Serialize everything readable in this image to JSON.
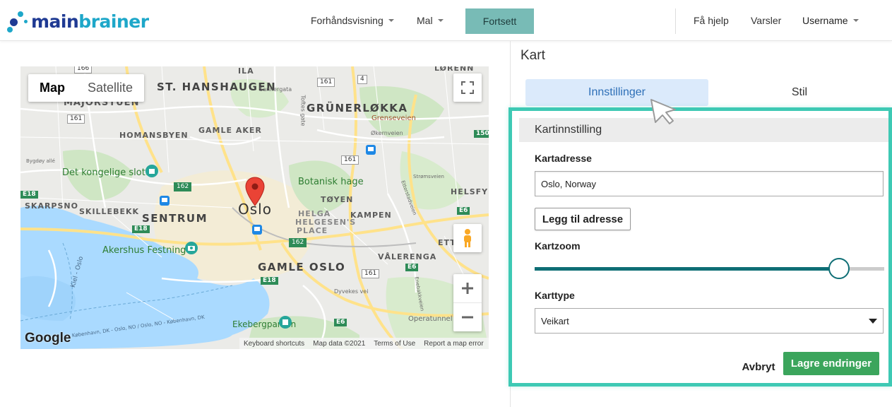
{
  "header": {
    "logo_main": "main",
    "logo_accent": "brainer",
    "nav": {
      "preview_label": "Forhåndsvisning",
      "template_label": "Mal",
      "continue_label": "Fortsett",
      "help_label": "Få hjelp",
      "alerts_label": "Varsler",
      "user_label": "Username"
    }
  },
  "map": {
    "map_type_selected": "Map",
    "map_type_other": "Satellite",
    "marker_city": "Oslo",
    "labels": {
      "st_hanshaugen": "ST. HANSHAUGEN",
      "grunerlokka": "GRÜNERLØKKA",
      "majorstuen": "MAJORSTUEN",
      "homansbyen": "HOMANSBYEN",
      "gamle_aker": "GAMLE AKER",
      "det_kongelige_slott": "Det kongelige slott",
      "botanisk_hage": "Botanisk hage",
      "skarpsno": "SKARPSNO",
      "skillebekk": "SKILLEBEKK",
      "sentrum": "SENTRUM",
      "helga_helgesens_plass_1": "HELGA",
      "helga_helgesens_plass_2": "HELGESEN'S",
      "helga_helgesens_plass_3": "PLACE",
      "toyen": "TØYEN",
      "kampen": "KAMPEN",
      "helsfyr": "HELSFYR",
      "etterstad": "ETTERST",
      "akershus_festning": "Akershus Festning",
      "valerenga": "VÅLERENGA",
      "gamle_oslo": "GAMLE OSLO",
      "ekebergparken": "Ekebergparken",
      "ila": "ILA",
      "lorenn": "LØRENN",
      "grenseveien": "Grenseveien",
      "okernveien": "Økernveien",
      "sannergata": "Sannergata",
      "tofles_gate": "Toftes gate",
      "dyvekes_vei": "Dyvekes vei",
      "operatunnelen": "Operatunnel",
      "kiel_oslo": "Kiel - Oslo",
      "kobenhavn": "København, DK - Oslo, NO / Oslo, NO - København, DK",
      "bygdoy_alle": "Bygdøy allé",
      "enebakkveien": "Enebakkveien",
      "strommsveien": "Strømsveien",
      "sinsenveien": "Etterstadveien",
      "r161": "161",
      "r162": "162",
      "r166": "166",
      "r150": "150",
      "r4": "4",
      "e18": "E18",
      "e6": "E6"
    },
    "footer": {
      "shortcuts": "Keyboard shortcuts",
      "data": "Map data ©2021",
      "terms": "Terms of Use",
      "report": "Report a map error",
      "google": "Google"
    }
  },
  "panel": {
    "title": "Kart",
    "tabs": [
      "Innstillinger",
      "Stil"
    ],
    "section_title": "Kartinnstilling",
    "address_label": "Kartadresse",
    "address_value": "Oslo, Norway",
    "add_address_label": "Legg til adresse",
    "zoom_label": "Kartzoom",
    "zoom_level_fraction": 0.87,
    "type_label": "Karttype",
    "type_value": "Veikart",
    "cancel_label": "Avbryt",
    "save_label": "Lagre endringer"
  },
  "colors": {
    "accent": "#3ec9b4",
    "save_button": "#3ba55c",
    "slider": "#0e6e75",
    "active_tab_bg": "#dbeafb",
    "continue_button": "#78bbb6"
  }
}
